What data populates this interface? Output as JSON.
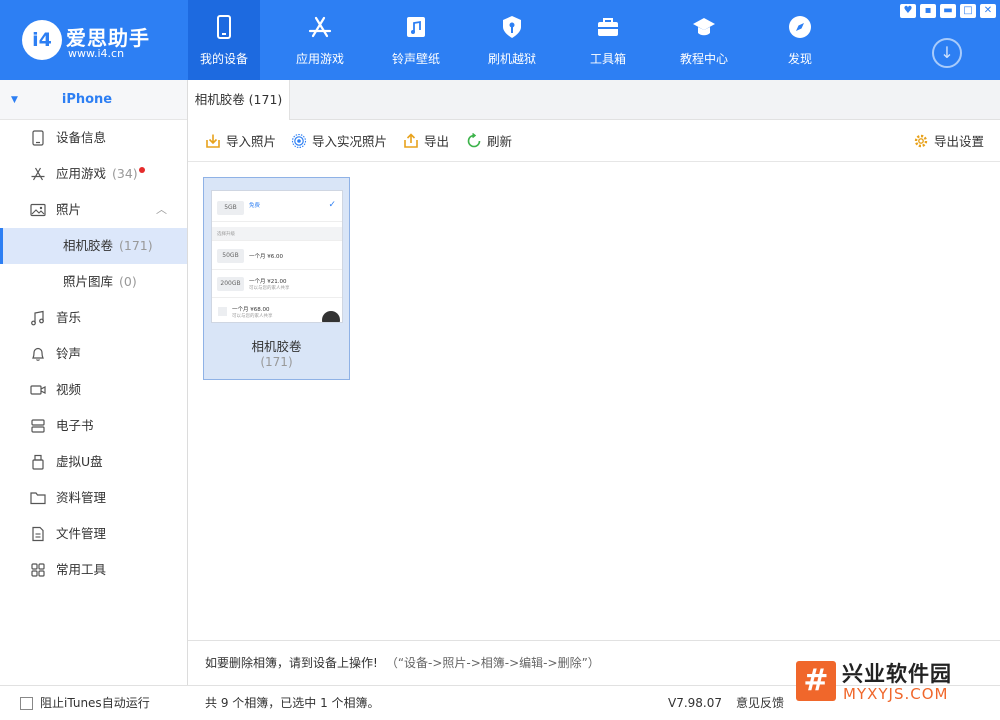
{
  "app": {
    "logo_mark": "i4",
    "name": "爱思助手",
    "url": "www.i4.cn"
  },
  "nav": [
    {
      "label": "我的设备",
      "icon": "phone-icon",
      "active": true
    },
    {
      "label": "应用游戏",
      "icon": "app-store-icon"
    },
    {
      "label": "铃声壁纸",
      "icon": "music-file-icon"
    },
    {
      "label": "刷机越狱",
      "icon": "shield-key-icon"
    },
    {
      "label": "工具箱",
      "icon": "toolbox-icon"
    },
    {
      "label": "教程中心",
      "icon": "graduation-cap-icon"
    },
    {
      "label": "发现",
      "icon": "compass-icon"
    }
  ],
  "window_controls": [
    "shirt-icon",
    "settings-icon",
    "minimize-icon",
    "maximize-icon",
    "close-icon"
  ],
  "sidebar": {
    "device": "iPhone",
    "items": [
      {
        "label": "设备信息",
        "icon": "tablet-icon"
      },
      {
        "label": "应用游戏",
        "count": "(34)",
        "icon": "app-store-icon",
        "badge": true
      },
      {
        "label": "照片",
        "icon": "image-icon",
        "expanded": true
      },
      {
        "label": "相机胶卷",
        "count": "(171)",
        "sub": true,
        "active": true
      },
      {
        "label": "照片图库",
        "count": "(0)",
        "sub": true
      },
      {
        "label": "音乐",
        "icon": "music-note-icon"
      },
      {
        "label": "铃声",
        "icon": "bell-icon"
      },
      {
        "label": "视频",
        "icon": "video-icon"
      },
      {
        "label": "电子书",
        "icon": "book-icon"
      },
      {
        "label": "虚拟U盘",
        "icon": "usb-icon"
      },
      {
        "label": "资料管理",
        "icon": "folder-icon"
      },
      {
        "label": "文件管理",
        "icon": "document-icon"
      },
      {
        "label": "常用工具",
        "icon": "grid-icon"
      }
    ]
  },
  "tab": {
    "label": "相机胶卷 (171)"
  },
  "toolbar": {
    "import_photos": "导入照片",
    "import_live": "导入实况照片",
    "export": "导出",
    "refresh": "刷新",
    "export_settings": "导出设置"
  },
  "album": {
    "name": "相机胶卷",
    "count": "(171)",
    "thumb": {
      "rows": [
        {
          "pill": "5GB",
          "text": "免费",
          "checked": true
        },
        {
          "section": "选择升级"
        },
        {
          "pill": "50GB",
          "text": "一个月 ¥6.00"
        },
        {
          "pill": "200GB",
          "text": "一个月 ¥21.00",
          "sub": "可以与您的家人共享"
        },
        {
          "text": "一个月 ¥68.00",
          "sub": "可以与您的家人共享"
        }
      ]
    }
  },
  "hint": {
    "strong": "如要删除相簿，请到设备上操作!",
    "path": "（“设备->照片->相簿->编辑->删除”）"
  },
  "statusbar": {
    "block_itunes": "阻止iTunes自动运行",
    "status": "共 9 个相簿，已选中 1 个相簿。",
    "version": "V7.98.07",
    "feedback": "意见反馈"
  },
  "watermark": {
    "mark": "#",
    "title": "兴业软件园",
    "url": "MYXYJS.COM"
  },
  "colors": {
    "brand": "#2d7ff3",
    "nav_active": "#1d6ae0",
    "selection": "#dce7fa",
    "badge_red": "#e52b2b",
    "watermark_orange": "#f0672b"
  }
}
